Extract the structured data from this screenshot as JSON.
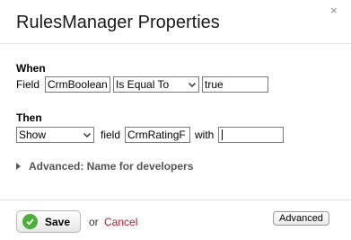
{
  "dialog": {
    "title": "RulesManager Properties",
    "close_glyph": "×"
  },
  "when": {
    "label": "When",
    "field_label": "Field",
    "field_value": "CrmBoolean",
    "operator_value": "Is Equal To",
    "compare_value": "true"
  },
  "then": {
    "label": "Then",
    "action_value": "Show",
    "field_label": "field",
    "field_value": "CrmRatingF",
    "with_label": "with",
    "with_value": ""
  },
  "advanced": {
    "toggle_label": "Advanced: Name for developers"
  },
  "footer": {
    "save_label": "Save",
    "or_text": "or",
    "cancel_label": "Cancel",
    "advanced_button_label": "Advanced"
  },
  "colors": {
    "cancel_link": "#c8102e",
    "save_check": "#4caf3a"
  }
}
